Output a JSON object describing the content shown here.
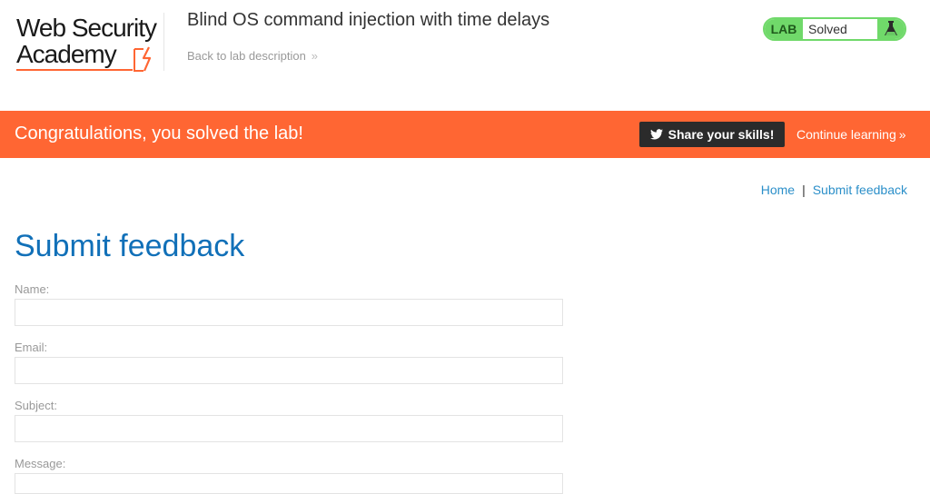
{
  "header": {
    "logo_line1": "Web Security",
    "logo_line2": "Academy",
    "lab_title": "Blind OS command injection with time delays",
    "back_link": "Back to lab description"
  },
  "status": {
    "badge": "LAB",
    "text": "Solved",
    "colors": {
      "badge_bg": "#70d96a",
      "border": "#70d96a"
    }
  },
  "banner": {
    "message": "Congratulations, you solved the lab!",
    "share_label": "Share your skills!",
    "continue_label": "Continue learning",
    "background": "#ff6633"
  },
  "nav": {
    "home": "Home",
    "separator": "|",
    "feedback": "Submit feedback"
  },
  "form": {
    "title": "Submit feedback",
    "fields": [
      {
        "label": "Name:",
        "value": "",
        "placeholder": ""
      },
      {
        "label": "Email:",
        "value": "",
        "placeholder": ""
      },
      {
        "label": "Subject:",
        "value": "",
        "placeholder": ""
      },
      {
        "label": "Message:",
        "value": "",
        "placeholder": ""
      }
    ]
  },
  "icons": [
    "logo-bolt-icon",
    "chevron-double-right-icon",
    "flask-icon",
    "twitter-icon"
  ]
}
